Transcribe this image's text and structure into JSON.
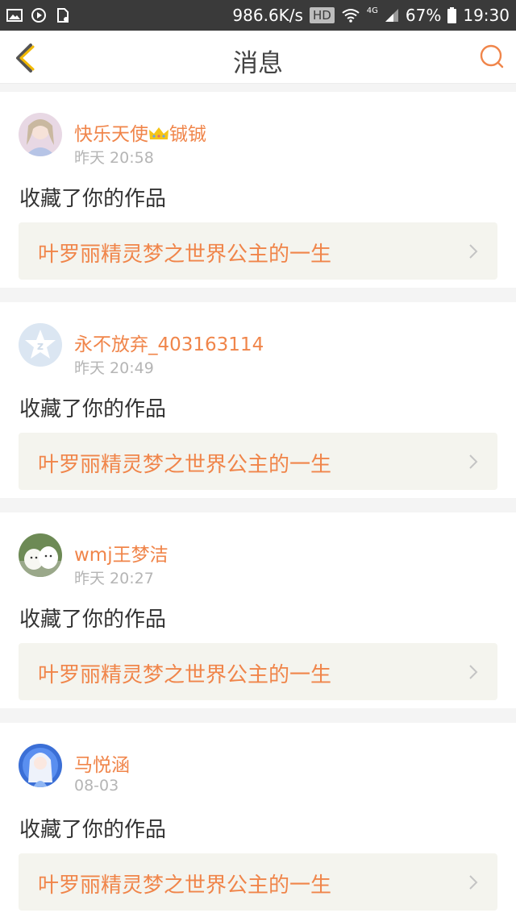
{
  "status_bar": {
    "speed": "986.6K/s",
    "hd": "HD",
    "network": "4G",
    "battery": "67%",
    "time": "19:30",
    "left_icons": [
      "image-icon",
      "play-icon",
      "file-icon"
    ]
  },
  "header": {
    "title": "消息",
    "back_icon": "chevron-left-icon",
    "action_icon": "search-circle-icon"
  },
  "messages": [
    {
      "name": "快乐天使",
      "name_suffix": "铖铖",
      "badge_icon": "crown-icon",
      "time": "昨天 20:58",
      "action": "收藏了你的作品",
      "work_title": "叶罗丽精灵梦之世界公主的一生"
    },
    {
      "name": "永不放弃_403163114",
      "name_suffix": "",
      "time": "昨天 20:49",
      "action": "收藏了你的作品",
      "work_title": "叶罗丽精灵梦之世界公主的一生"
    },
    {
      "name": "wmj王梦洁",
      "name_suffix": "",
      "time": "昨天 20:27",
      "action": "收藏了你的作品",
      "work_title": "叶罗丽精灵梦之世界公主的一生"
    },
    {
      "name": "马悦涵",
      "name_suffix": "",
      "time": "08-03",
      "action": "收藏了你的作品",
      "work_title": "叶罗丽精灵梦之世界公主的一生"
    }
  ],
  "colors": {
    "accent": "#f0854a",
    "status_bar": "#3a3a3a",
    "page_bg": "#f4f4f4",
    "work_box_bg": "#f4f4ee",
    "time_gray": "#b5b5b5",
    "back_yellow": "#f2b900"
  }
}
